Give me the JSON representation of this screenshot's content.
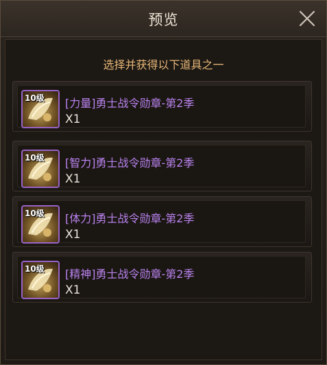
{
  "dialog": {
    "title": "预览",
    "subtitle": "选择并获得以下道具之一"
  },
  "items": [
    {
      "level": "10级",
      "name": "[力量]勇士战令勋章-第2季",
      "quantity": "X1",
      "icon": "medal-icon"
    },
    {
      "level": "10级",
      "name": "[智力]勇士战令勋章-第2季",
      "quantity": "X1",
      "icon": "medal-icon"
    },
    {
      "level": "10级",
      "name": "[体力]勇士战令勋章-第2季",
      "quantity": "X1",
      "icon": "medal-icon"
    },
    {
      "level": "10级",
      "name": "[精神]勇士战令勋章-第2季",
      "quantity": "X1",
      "icon": "medal-icon"
    }
  ],
  "colors": {
    "item_name": "#b983ee",
    "subtitle": "#e8b878",
    "icon_border": "#9a63c8"
  }
}
